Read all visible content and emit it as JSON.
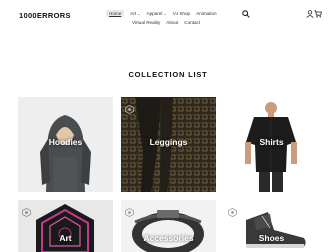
{
  "header": {
    "logo": "1000ERRORS",
    "nav_row1": [
      {
        "label": "Home",
        "active": true
      },
      {
        "label": "Art",
        "dropdown": true
      },
      {
        "label": "Apparel",
        "dropdown": true
      },
      {
        "label": "VJ Shop"
      },
      {
        "label": "Animation"
      }
    ],
    "nav_row2": [
      {
        "label": "Virtual Reality"
      },
      {
        "label": "About"
      },
      {
        "label": "Contact"
      }
    ],
    "icons": [
      "search-icon",
      "user-icon",
      "cart-icon"
    ]
  },
  "section_title": "COLLECTION LIST",
  "collections": [
    {
      "label": "Hoodies"
    },
    {
      "label": "Leggings"
    },
    {
      "label": "Shirts"
    },
    {
      "label": "Art"
    },
    {
      "label": "Accessories"
    },
    {
      "label": "Shoes"
    }
  ]
}
